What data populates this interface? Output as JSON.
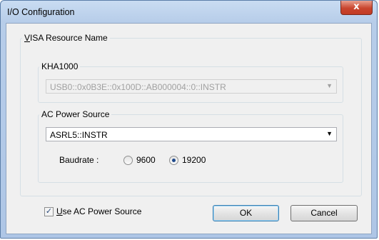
{
  "window": {
    "title": "I/O Configuration",
    "close_label": "x"
  },
  "visa_group": {
    "legend_prefix": "V",
    "legend_rest": "ISA Resource Name"
  },
  "kha_group": {
    "legend": "KHA1000",
    "resource_value": "USB0::0x0B3E::0x100D::AB000004::0::INSTR"
  },
  "ac_group": {
    "legend": "AC Power Source",
    "resource_value": "ASRL5::INSTR",
    "baudrate_label": "Baudrate :",
    "options": [
      "9600",
      "19200"
    ],
    "selected": "19200"
  },
  "use_ac": {
    "prefix": "U",
    "rest": "se AC Power Source",
    "checked": true
  },
  "buttons": {
    "ok": "OK",
    "cancel": "Cancel"
  },
  "icons": {
    "dropdown": "chevron-down-icon",
    "check": "check-icon"
  }
}
